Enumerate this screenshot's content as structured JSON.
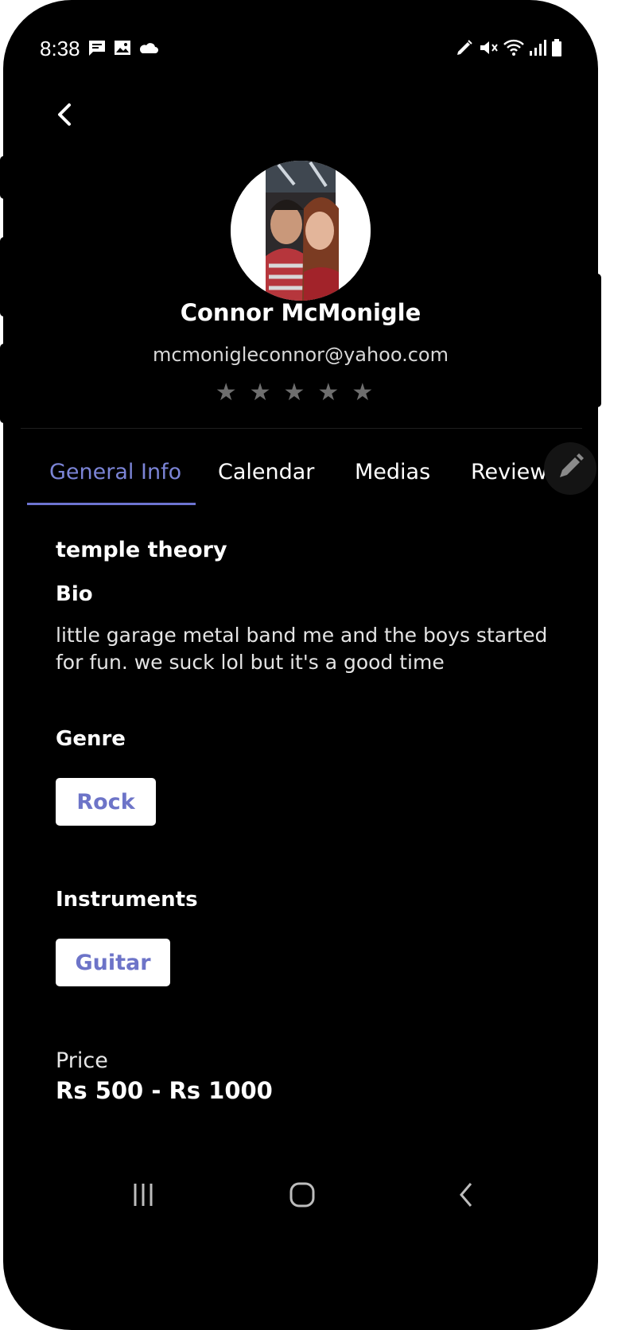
{
  "status_bar": {
    "time": "8:38",
    "left_icons": [
      "chat-icon",
      "image-icon",
      "cloud-icon"
    ],
    "right_icons": [
      "pen-icon",
      "mute-icon",
      "wifi-icon",
      "signal-icon",
      "battery-icon"
    ]
  },
  "profile": {
    "name": "Connor McMonigle",
    "email": "mcmonigleconnor@yahoo.com",
    "stars": "★★★★★"
  },
  "tabs": [
    {
      "label": "General Info",
      "active": true
    },
    {
      "label": "Calendar",
      "active": false
    },
    {
      "label": "Medias",
      "active": false
    },
    {
      "label": "Reviews",
      "active": false
    }
  ],
  "general_info": {
    "band_name": "temple theory",
    "bio_title": "Bio",
    "bio_text": "little garage metal band me and the boys started for fun. we suck lol but it's a good time",
    "genre_title": "Genre",
    "genre_chip": "Rock",
    "instruments_title": "Instruments",
    "instrument_chip": "Guitar",
    "price_label": "Price",
    "price_value": "Rs 500 - Rs 1000"
  },
  "colors": {
    "accent": "#6d74d1",
    "background": "#000000"
  }
}
